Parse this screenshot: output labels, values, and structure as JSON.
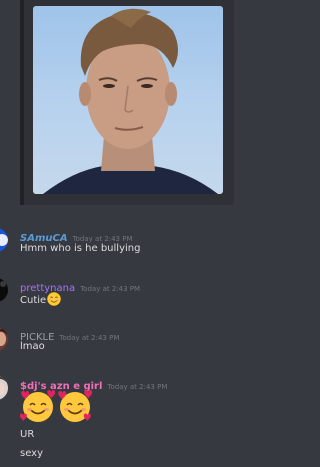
{
  "embed": {
    "image_alt": "selfie photo of a young man"
  },
  "messages": [
    {
      "username": "SAmuCA",
      "username_color": "#5a9bd8",
      "timestamp": "Today at 2:43 PM",
      "text": "Hmm who is he bullying"
    },
    {
      "username": "prettynana",
      "username_color": "#a970ff",
      "timestamp": "Today at 2:43 PM",
      "text": "Cutie",
      "emoji": "blush-emoji"
    },
    {
      "username": "PICKLE",
      "username_color": "#9a9ea6",
      "timestamp": "Today at 2:43 PM",
      "text": "lmao"
    },
    {
      "username": "$dj's azn e girl",
      "username_color": "#f070b8",
      "timestamp": "Today at 2:43 PM",
      "emoji": "smiling-face-with-hearts-emoji",
      "lines": [
        "UR",
        "sexy"
      ]
    }
  ]
}
